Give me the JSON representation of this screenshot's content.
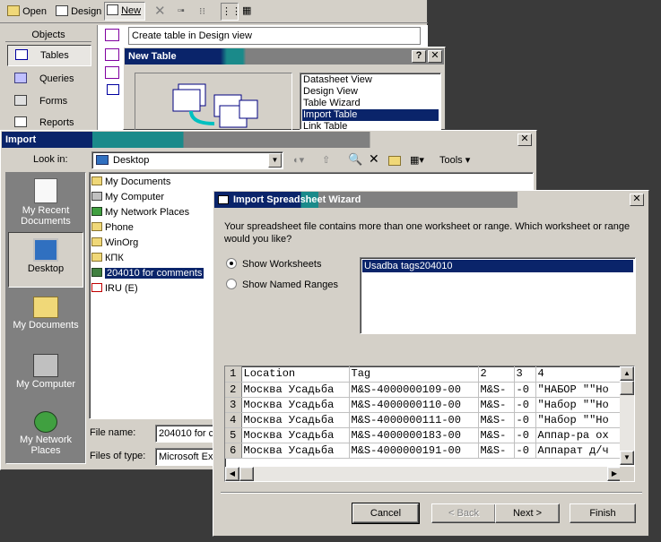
{
  "access_toolbar": {
    "open_label": "Open",
    "design_label": "Design",
    "new_label": "New"
  },
  "objects_bar": {
    "header": "Objects",
    "items": [
      {
        "label": "Tables"
      },
      {
        "label": "Queries"
      },
      {
        "label": "Forms"
      },
      {
        "label": "Reports"
      }
    ],
    "create_table_label": "Create table in Design view"
  },
  "new_table": {
    "title": "New Table",
    "options": [
      "Datasheet View",
      "Design View",
      "Table Wizard",
      "Import Table",
      "Link Table"
    ],
    "selected": "Import Table"
  },
  "import": {
    "title": "Import",
    "look_in_label": "Look in:",
    "look_in_value": "Desktop",
    "tools_label": "Tools",
    "places": [
      "My Recent Documents",
      "Desktop",
      "My Documents",
      "My Computer",
      "My Network Places"
    ],
    "files": [
      "My Documents",
      "My Computer",
      "My Network Places",
      "Phone",
      "WinOrg",
      "КПК",
      "204010 for comments",
      "IRU (E)"
    ],
    "selected_file": "204010 for comments",
    "file_name_label": "File name:",
    "file_name_value": "204010 for c",
    "file_type_label": "Files of type:",
    "file_type_value": "Microsoft Exc"
  },
  "wizard": {
    "title": "Import Spreadsheet Wizard",
    "prompt": "Your spreadsheet file contains more than one worksheet or range. Which worksheet or range would you like?",
    "show_worksheets_label": "Show Worksheets",
    "show_named_ranges_label": "Show Named Ranges",
    "selected_option": "Show Worksheets",
    "worksheets": [
      "Usadba tags204010"
    ],
    "preview": {
      "columns": [
        "Location",
        "Tag",
        "2",
        "3",
        "4"
      ],
      "rows": [
        {
          "n": "1",
          "cells": [
            "Location",
            "Tag",
            "2",
            "3",
            "4"
          ]
        },
        {
          "n": "2",
          "cells": [
            "Москва Усадьба",
            "M&S-4000000109-00",
            "M&S-",
            "-0",
            "\"НАБОР \"\"Но"
          ]
        },
        {
          "n": "3",
          "cells": [
            "Москва Усадьба",
            "M&S-4000000110-00",
            "M&S-",
            "-0",
            "\"Набор \"\"Но"
          ]
        },
        {
          "n": "4",
          "cells": [
            "Москва Усадьба",
            "M&S-4000000111-00",
            "M&S-",
            "-0",
            "\"Набор \"\"Но"
          ]
        },
        {
          "n": "5",
          "cells": [
            "Москва Усадьба",
            "M&S-4000000183-00",
            "M&S-",
            "-0",
            "Аппар-ра ох"
          ]
        },
        {
          "n": "6",
          "cells": [
            "Москва Усадьба",
            "M&S-4000000191-00",
            "M&S-",
            "-0",
            "Аппарат д/ч"
          ]
        }
      ]
    },
    "buttons": {
      "cancel": "Cancel",
      "back": "< Back",
      "next": "Next >",
      "finish": "Finish"
    }
  },
  "colors": {
    "face": "#d4d0c8",
    "title_active": "#0a246a",
    "title_gradient": "#a6caf0",
    "selection": "#0a246a"
  }
}
